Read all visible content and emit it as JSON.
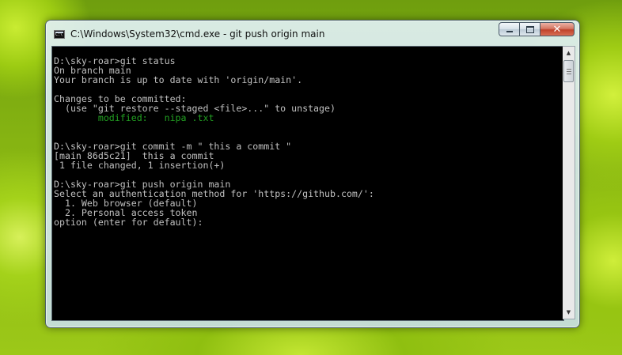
{
  "window": {
    "title": "C:\\Windows\\System32\\cmd.exe - git  push origin main",
    "controls": {
      "minimize_icon": "minimize-icon",
      "maximize_icon": "maximize-icon",
      "close_icon": "close-icon",
      "close_glyph": "✕"
    }
  },
  "console": {
    "lines": [
      "D:\\sky-roar>git status",
      "On branch main",
      "Your branch is up to date with 'origin/main'.",
      "",
      "Changes to be committed:",
      "  (use \"git restore --staged <file>...\" to unstage)",
      "        modified:   nipa .txt",
      "",
      "",
      "D:\\sky-roar>git commit -m \" this a commit \"",
      "[main 86d5c21]  this a commit",
      " 1 file changed, 1 insertion(+)",
      "",
      "D:\\sky-roar>git push origin main",
      "Select an authentication method for 'https://github.com/':",
      "  1. Web browser (default)",
      "  2. Personal access token",
      "option (enter for default):"
    ],
    "colors": {
      "background": "#000000",
      "text": "#c0c0c0",
      "modified": "#22a022"
    }
  },
  "scrollbar": {
    "up_glyph": "▲",
    "down_glyph": "▼"
  }
}
